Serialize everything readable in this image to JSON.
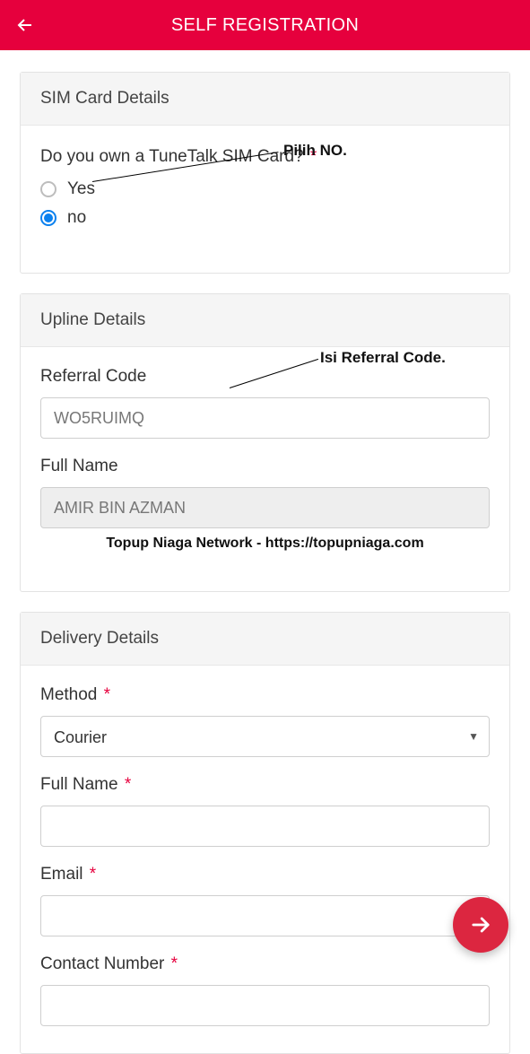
{
  "header": {
    "title": "SELF REGISTRATION"
  },
  "sim": {
    "section_title": "SIM Card Details",
    "question": "Do you own a TuneTalk SIM Card?",
    "required": "*",
    "option_yes": "Yes",
    "option_no": "no",
    "annotation": "Pilih NO."
  },
  "upline": {
    "section_title": "Upline Details",
    "referral_label": "Referral Code",
    "referral_value": "WO5RUIMQ",
    "fullname_label": "Full Name",
    "fullname_value": "AMIR BIN AZMAN",
    "annotation": "Isi Referral Code.",
    "watermark": "Topup Niaga Network - https://topupniaga.com"
  },
  "delivery": {
    "section_title": "Delivery Details",
    "method_label": "Method",
    "method_value": "Courier",
    "fullname_label": "Full Name",
    "fullname_value": "",
    "email_label": "Email",
    "email_value": "",
    "contact_label": "Contact Number",
    "contact_value": "",
    "required": "*"
  },
  "colors": {
    "brand_red": "#e6003d",
    "fab_red": "#dc2640",
    "radio_blue": "#0b81ef"
  }
}
